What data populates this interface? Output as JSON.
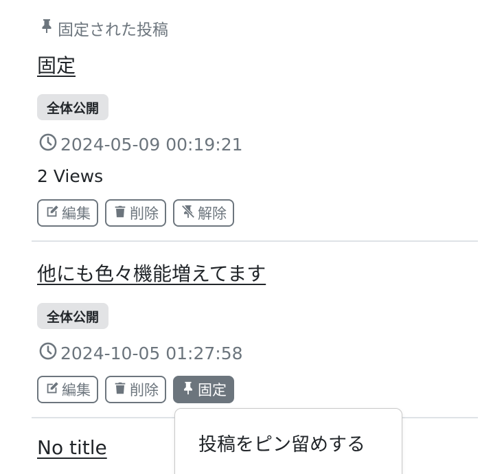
{
  "pinned_section": {
    "label": "固定された投稿"
  },
  "posts": [
    {
      "title": "固定",
      "visibility": "全体公開",
      "datetime": "2024-05-09 00:19:21",
      "views": "2 Views",
      "actions": {
        "edit": "編集",
        "delete": "削除",
        "unpin": "解除"
      }
    },
    {
      "title": "他にも色々機能増えてます",
      "visibility": "全体公開",
      "datetime": "2024-10-05 01:27:58",
      "actions": {
        "edit": "編集",
        "delete": "削除",
        "pin": "固定"
      }
    },
    {
      "title": "No title"
    }
  ],
  "dropdown": {
    "pin_item": "投稿をピン留めする"
  },
  "colors": {
    "muted": "#6c757d",
    "badge_bg": "#e2e3e5",
    "text": "#212529",
    "divider": "#dee2e6"
  },
  "icons": [
    "pin-icon",
    "clock-icon",
    "edit-icon",
    "trash-icon",
    "unpin-icon"
  ]
}
